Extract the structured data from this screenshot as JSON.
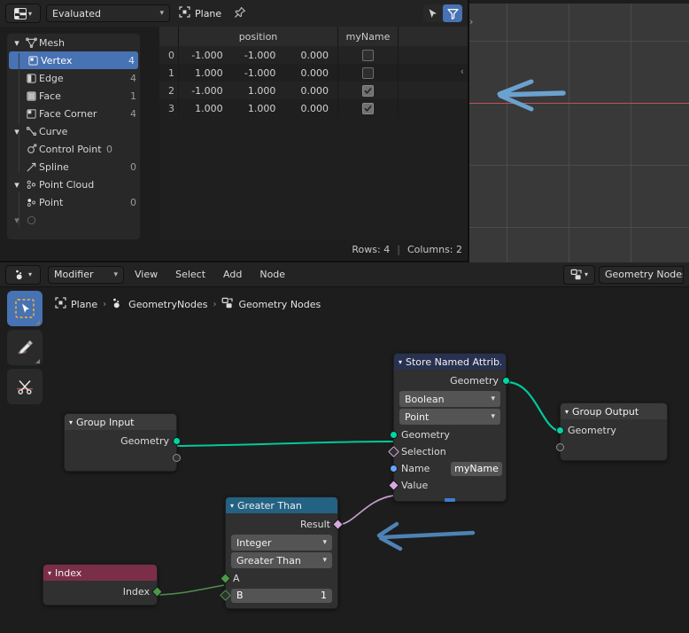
{
  "spreadsheet": {
    "editor_type_icon": "spreadsheet-editor-icon",
    "dataset_dropdown": "Evaluated",
    "object_icon": "object-data-icon",
    "object_name": "Plane",
    "pin_icon": "pin-icon",
    "cursor_icon": "cursor-icon",
    "filter_icon": "filter-icon",
    "tree": [
      {
        "label": "Mesh",
        "count": "",
        "level": 0,
        "expand": true,
        "icon": "mesh-data-icon",
        "selected": false
      },
      {
        "label": "Vertex",
        "count": "4",
        "level": 1,
        "expand": false,
        "icon": "vertex-icon",
        "selected": true
      },
      {
        "label": "Edge",
        "count": "4",
        "level": 1,
        "expand": false,
        "icon": "edge-icon",
        "selected": false
      },
      {
        "label": "Face",
        "count": "1",
        "level": 1,
        "expand": false,
        "icon": "face-icon",
        "selected": false
      },
      {
        "label": "Face Corner",
        "count": "4",
        "level": 1,
        "expand": false,
        "icon": "face-corner-icon",
        "selected": false
      },
      {
        "label": "Curve",
        "count": "",
        "level": 0,
        "expand": true,
        "icon": "curve-data-icon",
        "selected": false
      },
      {
        "label": "Control Point",
        "count": "0",
        "level": 1,
        "expand": false,
        "icon": "control-point-icon",
        "selected": false
      },
      {
        "label": "Spline",
        "count": "0",
        "level": 1,
        "expand": false,
        "icon": "spline-icon",
        "selected": false
      },
      {
        "label": "Point Cloud",
        "count": "",
        "level": 0,
        "expand": true,
        "icon": "point-cloud-icon",
        "selected": false
      },
      {
        "label": "Point",
        "count": "0",
        "level": 1,
        "expand": false,
        "icon": "point-icon",
        "selected": false
      }
    ],
    "table": {
      "columns": [
        "",
        "position",
        "myName",
        ""
      ],
      "rows": [
        {
          "index": "0",
          "x": "-1.000",
          "y": "-1.000",
          "z": "0.000",
          "myName": false
        },
        {
          "index": "1",
          "x": "1.000",
          "y": "-1.000",
          "z": "0.000",
          "myName": false
        },
        {
          "index": "2",
          "x": "-1.000",
          "y": "1.000",
          "z": "0.000",
          "myName": true
        },
        {
          "index": "3",
          "x": "1.000",
          "y": "1.000",
          "z": "0.000",
          "myName": true
        }
      ]
    },
    "footer": {
      "rows": "Rows: 4",
      "separator": "|",
      "columns": "Columns: 2"
    },
    "collapse_arrow": "‹"
  },
  "viewport": {
    "collapse_arrow": "›",
    "grid_color": "#4b4b4b",
    "axis_x_color": "#c0515c",
    "background": "#393939",
    "annotation_color": "#6aa2cf"
  },
  "node_editor": {
    "editor_type_icon": "geometry-node-editor-icon",
    "mode_dropdown": "Modifier",
    "menus": [
      "View",
      "Select",
      "Add",
      "Node"
    ],
    "tree_type_icon": "node-tree-icon",
    "tree_name": "Geometry Nodes",
    "breadcrumb": [
      {
        "label": "Plane",
        "icon": "object-data-icon"
      },
      {
        "label": "GeometryNodes",
        "icon": "modifier-icon"
      },
      {
        "label": "Geometry Nodes",
        "icon": "node-tree-icon"
      }
    ],
    "breadcrumb_separator": "›",
    "tools": [
      {
        "name": "tweak-tool",
        "icon": "cursor-arrow-icon",
        "active": true
      },
      {
        "name": "annotate-tool",
        "icon": "pencil-icon",
        "active": false
      },
      {
        "name": "cut-links-tool",
        "icon": "scissors-icon",
        "active": false
      }
    ],
    "nodes": {
      "group_input": {
        "title": "Group Input",
        "header_color": "#3b3b3b",
        "outputs": [
          {
            "label": "Geometry",
            "color": "#00d6a3",
            "shape": "circle"
          },
          {
            "label": "",
            "color": "#303030",
            "shape": "circle"
          }
        ]
      },
      "group_output": {
        "title": "Group Output",
        "header_color": "#3b3b3b",
        "inputs": [
          {
            "label": "Geometry",
            "color": "#00d6a3",
            "shape": "circle"
          },
          {
            "label": "",
            "color": "#303030",
            "shape": "circle"
          }
        ]
      },
      "store_named_attribute": {
        "title": "Store Named Attrib...",
        "header_color": "#283250",
        "data_type": "Boolean",
        "domain": "Point",
        "outputs": [
          {
            "label": "Geometry",
            "color": "#00d6a3",
            "shape": "circle"
          }
        ],
        "inputs": [
          {
            "label": "Geometry",
            "color": "#00d6a3",
            "shape": "circle"
          },
          {
            "label": "Selection",
            "color": "#d6a9e0",
            "shape": "diamond-dot"
          },
          {
            "label": "Name",
            "color": "#63a4ff",
            "shape": "circle",
            "value": "myName"
          },
          {
            "label": "Value",
            "color": "#d6a9e0",
            "shape": "diamond"
          }
        ]
      },
      "greater_than": {
        "title": "Greater Than",
        "header_color": "#246283",
        "data_type": "Integer",
        "operation": "Greater Than",
        "outputs": [
          {
            "label": "Result",
            "color": "#d6a9e0",
            "shape": "diamond"
          }
        ],
        "inputs": [
          {
            "label": "A",
            "color": "#4a9a4a",
            "shape": "diamond"
          },
          {
            "label": "B",
            "color": "#4a9a4a",
            "shape": "diamond-dot",
            "value": "1"
          }
        ]
      },
      "index": {
        "title": "Index",
        "header_color": "#7b2e47",
        "outputs": [
          {
            "label": "Index",
            "color": "#4a9a4a",
            "shape": "diamond"
          }
        ]
      }
    },
    "link_colors": {
      "geometry": "#00c99a",
      "field_boolean": "#c2a0cc",
      "field_int": "#4f8f4f"
    },
    "annotation_color": "#6aa2cf"
  }
}
